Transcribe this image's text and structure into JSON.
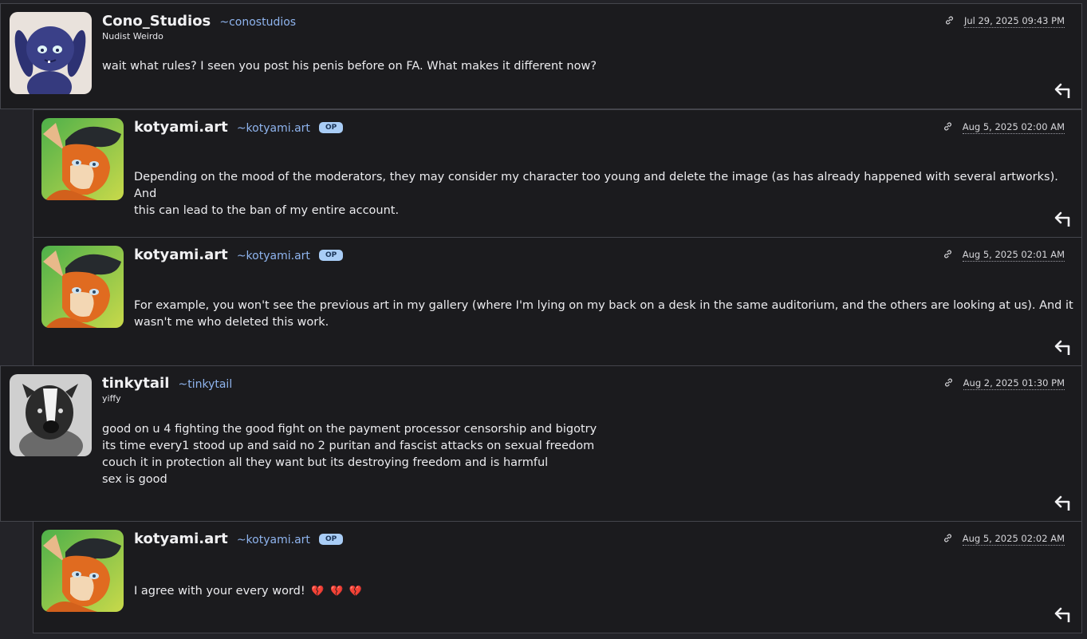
{
  "comments": [
    {
      "username": "Cono_Studios",
      "handle": "~conostudios",
      "title": "Nudist Weirdo",
      "date": "Jul 29, 2025 09:43 PM",
      "text": "wait what rules? I seen you post his penis before on FA. What makes it different now?",
      "avatar_icon": "blue-bunny-avatar"
    },
    {
      "username": "kotyami.art",
      "handle": "~kotyami.art",
      "badge": "OP",
      "date": "Aug 5, 2025 02:00 AM",
      "lines": [
        "Depending on the mood of the moderators, they may consider my character too young and delete the image (as has already happened with several artworks). And",
        "this can lead to the ban of my entire account."
      ],
      "avatar_icon": "orange-fox-avatar"
    },
    {
      "username": "kotyami.art",
      "handle": "~kotyami.art",
      "badge": "OP",
      "date": "Aug 5, 2025 02:01 AM",
      "lines": [
        "For example, you won't see the previous art in my gallery (where I'm lying on my back on a desk in the same auditorium, and the others are looking at us). And it",
        "wasn't me who deleted this work."
      ],
      "avatar_icon": "orange-fox-avatar"
    },
    {
      "username": "tinkytail",
      "handle": "~tinkytail",
      "title": "yiffy",
      "date": "Aug 2, 2025 01:30 PM",
      "lines": [
        "good on u 4 fighting the good fight on the payment processor censorship and bigotry",
        "its time every1 stood up and said no 2 puritan and fascist attacks on sexual freedom",
        "couch it in protection all they want but its destroying freedom and is harmful",
        "sex is good"
      ],
      "avatar_icon": "grey-badger-avatar"
    },
    {
      "username": "kotyami.art",
      "handle": "~kotyami.art",
      "badge": "OP",
      "date": "Aug 5, 2025 02:02 AM",
      "text": "I agree with your every word!",
      "emojis": [
        "💔",
        "💔",
        "💔"
      ],
      "avatar_icon": "orange-fox-avatar"
    }
  ],
  "icons": {
    "link": "link-icon",
    "reply": "reply-icon",
    "emoji": "broken-heart-icon"
  },
  "colors": {
    "handle": "#8fb4ee",
    "op_badge_bg": "#a9cdf6",
    "card_bg": "#1b1b1e",
    "page_bg": "#232328"
  }
}
